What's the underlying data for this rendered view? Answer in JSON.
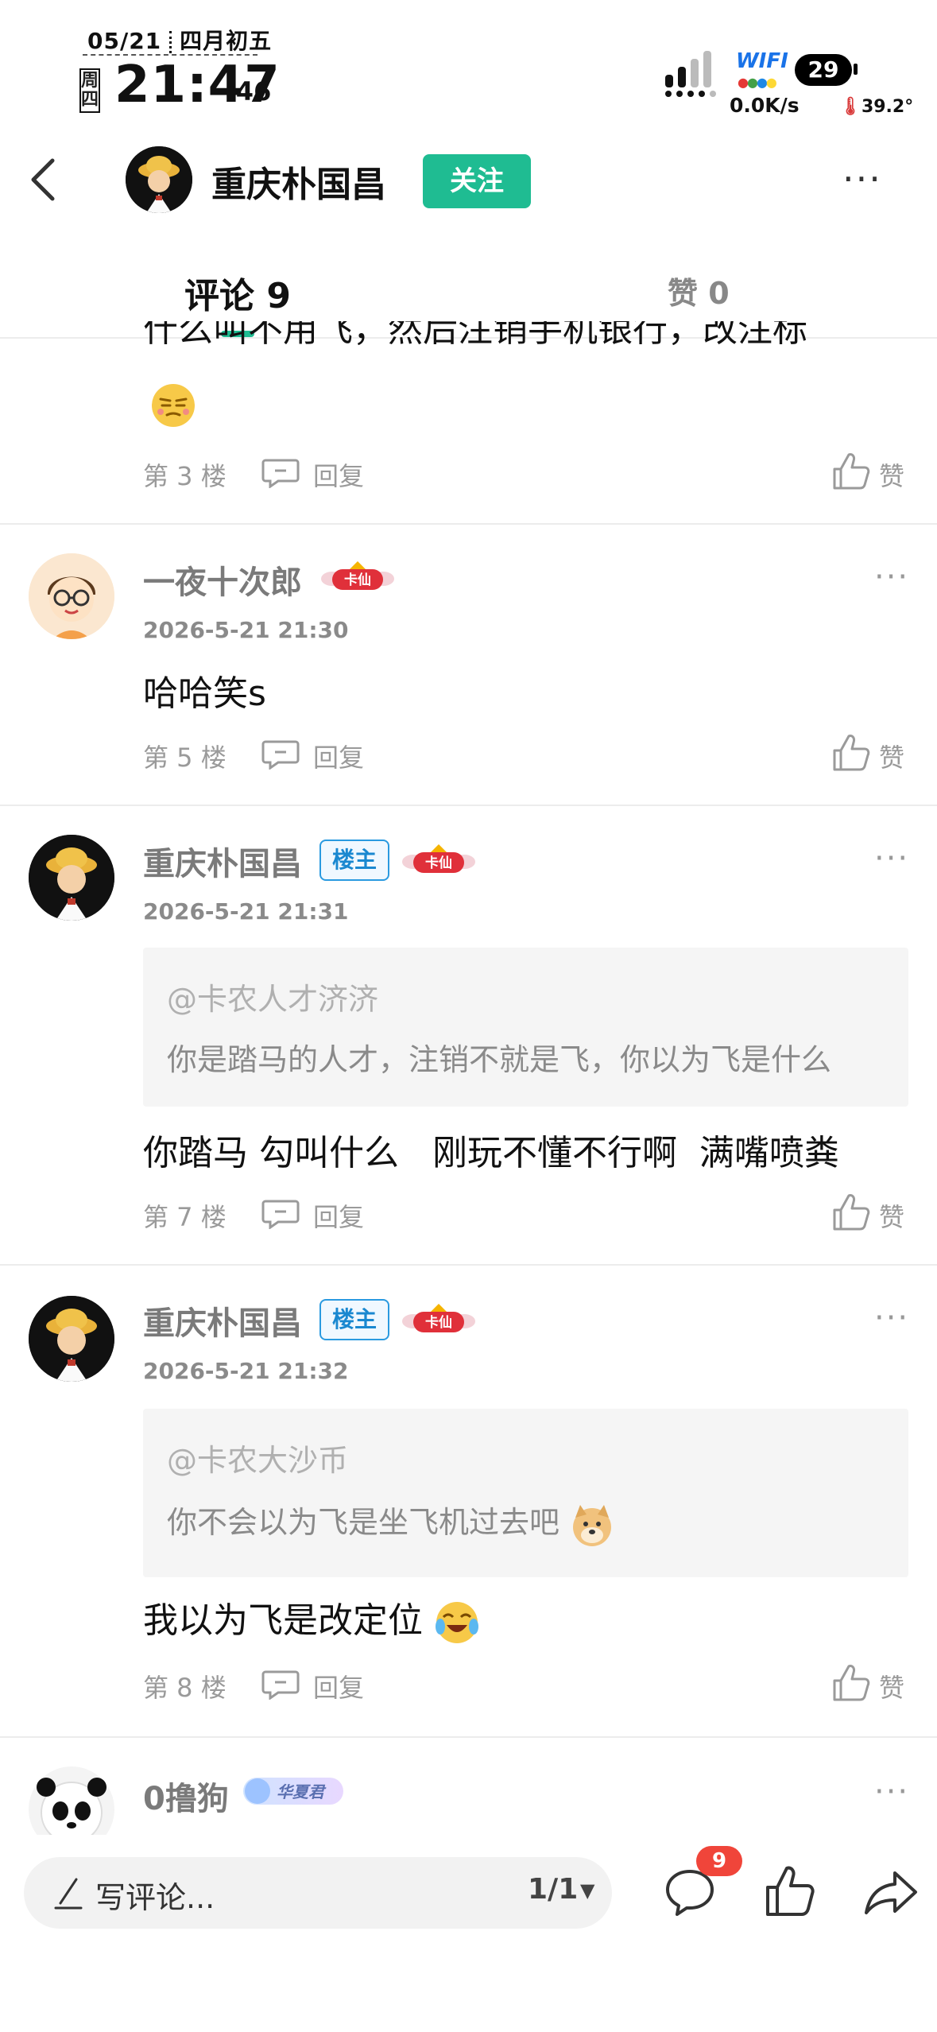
{
  "status_bar": {
    "date": "05/21",
    "lunar": "四月初五",
    "weekday": "周四",
    "time": "21:47",
    "seconds": ":46",
    "wifi_label": "WIFI",
    "battery": "29",
    "speed": "0.0K/s",
    "temperature": "39.2°"
  },
  "header": {
    "author": "重庆朴国昌",
    "follow_label": "关注"
  },
  "tabs": {
    "comments": "评论 9",
    "likes": "赞 0"
  },
  "partial_comment": {
    "content": "什么叫不用飞，然后注销手机银行，改注标",
    "floor": "第 3 楼",
    "reply": "回复",
    "like": "赞"
  },
  "comments": [
    {
      "user": "一夜十次郎",
      "badge": "卡仙",
      "time": "2026-5-21 21:30",
      "content": "哈哈笑s",
      "floor": "第 5 楼",
      "reply": "回复",
      "like": "赞"
    },
    {
      "user": "重庆朴国昌",
      "owner_badge": "楼主",
      "badge": "卡仙",
      "time": "2026-5-21 21:31",
      "quote_user": "@卡农人才济济",
      "quote_text": "你是踏马的人才，注销不就是飞，你以为飞是什么",
      "content": "你踏马 勾叫什么   刚玩不懂不行啊  满嘴喷粪",
      "floor": "第 7 楼",
      "reply": "回复",
      "like": "赞"
    },
    {
      "user": "重庆朴国昌",
      "owner_badge": "楼主",
      "badge": "卡仙",
      "time": "2026-5-21 21:32",
      "quote_user": "@卡农大沙币",
      "quote_text": "你不会以为飞是坐飞机过去吧",
      "content": "我以为飞是改定位",
      "floor": "第 8 楼",
      "reply": "回复",
      "like": "赞"
    },
    {
      "user": "0撸狗",
      "badge_art": "华夏君"
    }
  ],
  "bottom_bar": {
    "placeholder": "写评论...",
    "page": "1/1",
    "comment_count": "9"
  },
  "colors": {
    "accent": "#1fbc92",
    "notification": "#f0453a",
    "owner_badge": "#2a9ae0"
  },
  "icons": [
    "back-arrow-icon",
    "more-icon",
    "reply-icon",
    "like-icon",
    "pen-icon",
    "comment-icon",
    "share-icon",
    "signal-icon",
    "battery-icon",
    "thermometer-icon"
  ]
}
